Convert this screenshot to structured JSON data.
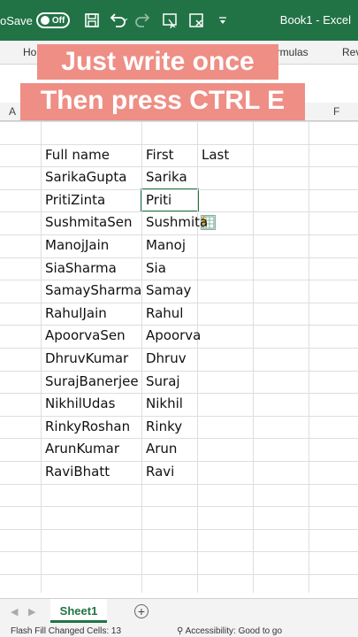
{
  "titlebar": {
    "autosave_label": "oSave",
    "toggle_label": "Off",
    "book_title": "Book1 - Excel"
  },
  "ribbon": {
    "tabs": [
      "Ho",
      "ormulas",
      "Rev"
    ]
  },
  "caption": {
    "line1": "Just write once",
    "line2": "Then press CTRL E"
  },
  "columns": {
    "left": "A",
    "right": "F"
  },
  "table": {
    "headers": [
      "Full name",
      "First",
      "Last"
    ],
    "full_names": [
      "SarikaGupta",
      "PritiZinta",
      "SushmitaSen",
      "ManojJain",
      "SiaSharma",
      "SamaySharma",
      "RahulJain",
      "ApoorvaSen",
      "DhruvKumar",
      "SurajBanerjee",
      "NikhilUdas",
      "RinkyRoshan",
      "ArunKumar",
      "RaviBhatt"
    ],
    "first_names": [
      "Sarika",
      "Priti",
      "Sushmita",
      "Manoj",
      "Sia",
      "Samay",
      "Rahul",
      "Apoorva",
      "Dhruv",
      "Suraj",
      "Nikhil",
      "Rinky",
      "Arun",
      "Ravi"
    ]
  },
  "sheets": {
    "active": "Sheet1",
    "add_symbol": "+"
  },
  "status": {
    "flash_fill": "Flash Fill Changed Cells: 13",
    "accessibility": "Accessibility: Good to go"
  },
  "colors": {
    "excel_green": "#217346",
    "caption_bg": "#ee8e85"
  }
}
